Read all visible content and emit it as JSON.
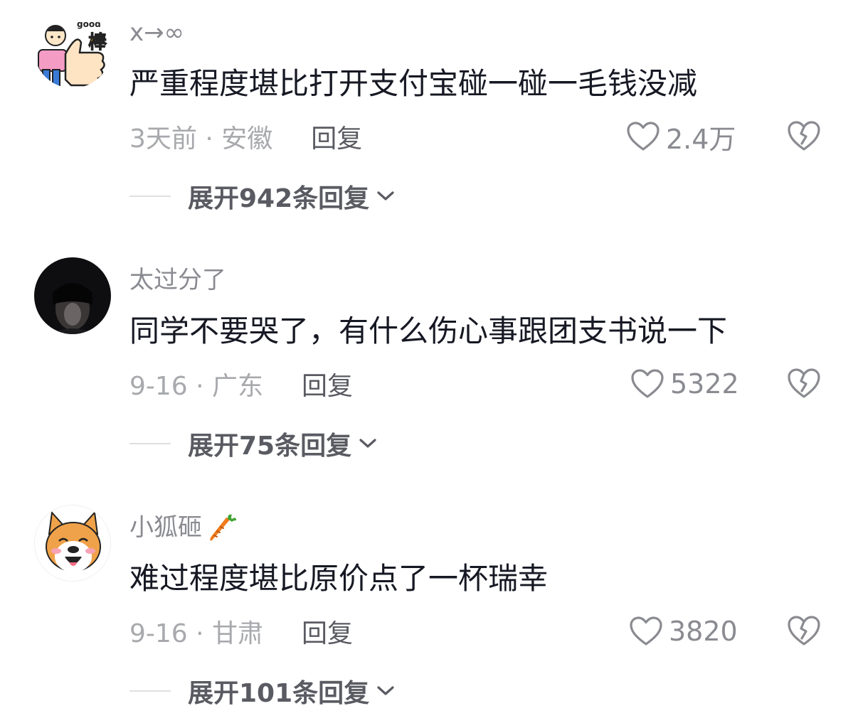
{
  "comments": [
    {
      "username": "x→∞",
      "text": "严重程度堪比打开支付宝碰一碰一毛钱没减",
      "meta": "3天前 · 安徽",
      "reply_label": "回复",
      "likes": "2.4万",
      "expand_label": "展开942条回复",
      "avatar_icon": "good-thumbs-up-cartoon"
    },
    {
      "username": "太过分了",
      "text": "同学不要哭了，有什么伤心事跟团支书说一下",
      "meta": "9-16 · 广东",
      "reply_label": "回复",
      "likes": "5322",
      "expand_label": "展开75条回复",
      "avatar_icon": "dark-portrait-photo"
    },
    {
      "username": "小狐砸",
      "username_emoji": "carrot-emoji",
      "text": "难过程度堪比原价点了一杯瑞幸",
      "meta": "9-16 · 甘肃",
      "reply_label": "回复",
      "likes": "3820",
      "expand_label": "展开101条回复",
      "avatar_icon": "shiba-dog-cartoon"
    }
  ],
  "icons": {
    "like": "heart-outline-icon",
    "dislike": "broken-heart-icon",
    "expand": "chevron-down-icon"
  },
  "colors": {
    "username": "#8a8b91",
    "text": "#161823",
    "meta": "#a8a9ad",
    "reply": "#5a5b62"
  }
}
